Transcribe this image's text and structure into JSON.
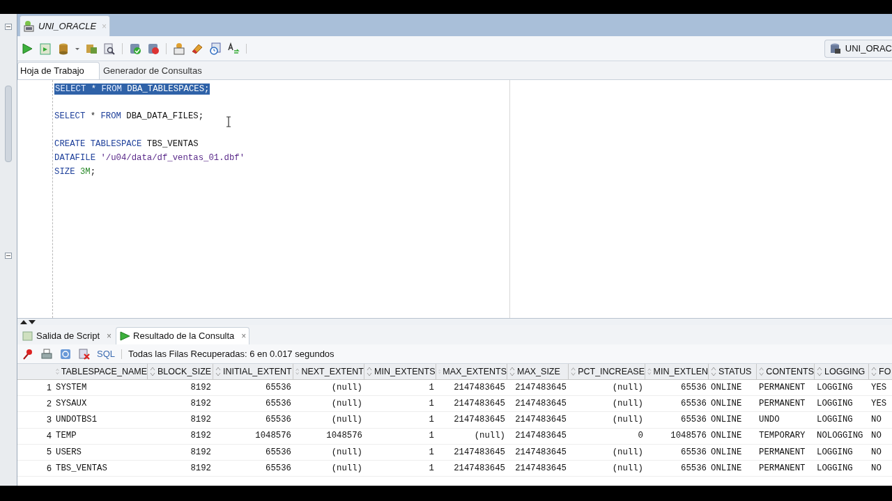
{
  "editor_tab": {
    "title": "UNI_ORACLE",
    "close": "×"
  },
  "connection": {
    "label": "UNI_ORAC"
  },
  "worksheet_tabs": [
    {
      "label": "Hoja de Trabajo",
      "selected": true
    },
    {
      "label": "Generador de Consultas",
      "selected": false
    }
  ],
  "code_lines": [
    {
      "kind": "code",
      "highlighted": true,
      "tokens": [
        {
          "kind": "keyword",
          "text": "SELECT"
        },
        {
          "kind": "punct",
          "text": " * "
        },
        {
          "kind": "keyword",
          "text": "FROM"
        },
        {
          "kind": "ident",
          "text": " DBA_TABLESPACES;"
        }
      ]
    },
    {
      "kind": "blank"
    },
    {
      "kind": "code",
      "highlighted": false,
      "tokens": [
        {
          "kind": "keyword",
          "text": "SELECT"
        },
        {
          "kind": "punct",
          "text": " * "
        },
        {
          "kind": "keyword",
          "text": "FROM"
        },
        {
          "kind": "ident",
          "text": " DBA_DATA_FILES;"
        }
      ]
    },
    {
      "kind": "blank"
    },
    {
      "kind": "code",
      "highlighted": false,
      "tokens": [
        {
          "kind": "keyword",
          "text": "CREATE TABLESPACE"
        },
        {
          "kind": "ident",
          "text": " TBS_VENTAS"
        }
      ]
    },
    {
      "kind": "code",
      "highlighted": false,
      "tokens": [
        {
          "kind": "keyword",
          "text": "DATAFILE"
        },
        {
          "kind": "string",
          "text": " '/u04/data/df_ventas_01.dbf'"
        }
      ]
    },
    {
      "kind": "code",
      "highlighted": false,
      "tokens": [
        {
          "kind": "keyword",
          "text": "SIZE"
        },
        {
          "kind": "number",
          "text": " 3M"
        },
        {
          "kind": "ident",
          "text": ";"
        }
      ]
    }
  ],
  "result_tabs": [
    {
      "label": "Salida de Script",
      "close": "×",
      "selected": false
    },
    {
      "label": "Resultado de la Consulta",
      "close": "×",
      "selected": true
    }
  ],
  "result_toolbar": {
    "sql_link": "SQL",
    "status": "Todas las Filas Recuperadas: 6 en 0.017 segundos"
  },
  "table": {
    "columns": [
      "TABLESPACE_NAME",
      "BLOCK_SIZE",
      "INITIAL_EXTENT",
      "NEXT_EXTENT",
      "MIN_EXTENTS",
      "MAX_EXTENTS",
      "MAX_SIZE",
      "PCT_INCREASE",
      "MIN_EXTLEN",
      "STATUS",
      "CONTENTS",
      "LOGGING",
      "FO"
    ],
    "rows": [
      {
        "num": "1",
        "cells": [
          "SYSTEM",
          "8192",
          "65536",
          "(null)",
          "1",
          "2147483645",
          "2147483645",
          "(null)",
          "65536",
          "ONLINE",
          "PERMANENT",
          "LOGGING",
          "YES"
        ]
      },
      {
        "num": "2",
        "cells": [
          "SYSAUX",
          "8192",
          "65536",
          "(null)",
          "1",
          "2147483645",
          "2147483645",
          "(null)",
          "65536",
          "ONLINE",
          "PERMANENT",
          "LOGGING",
          "YES"
        ]
      },
      {
        "num": "3",
        "cells": [
          "UNDOTBS1",
          "8192",
          "65536",
          "(null)",
          "1",
          "2147483645",
          "2147483645",
          "(null)",
          "65536",
          "ONLINE",
          "UNDO",
          "LOGGING",
          "NO"
        ]
      },
      {
        "num": "4",
        "cells": [
          "TEMP",
          "8192",
          "1048576",
          "1048576",
          "1",
          "(null)",
          "2147483645",
          "0",
          "1048576",
          "ONLINE",
          "TEMPORARY",
          "NOLOGGING",
          "NO"
        ]
      },
      {
        "num": "5",
        "cells": [
          "USERS",
          "8192",
          "65536",
          "(null)",
          "1",
          "2147483645",
          "2147483645",
          "(null)",
          "65536",
          "ONLINE",
          "PERMANENT",
          "LOGGING",
          "NO"
        ]
      },
      {
        "num": "6",
        "cells": [
          "TBS_VENTAS",
          "8192",
          "65536",
          "(null)",
          "1",
          "2147483645",
          "2147483645",
          "(null)",
          "65536",
          "ONLINE",
          "PERMANENT",
          "LOGGING",
          "NO"
        ]
      }
    ]
  }
}
